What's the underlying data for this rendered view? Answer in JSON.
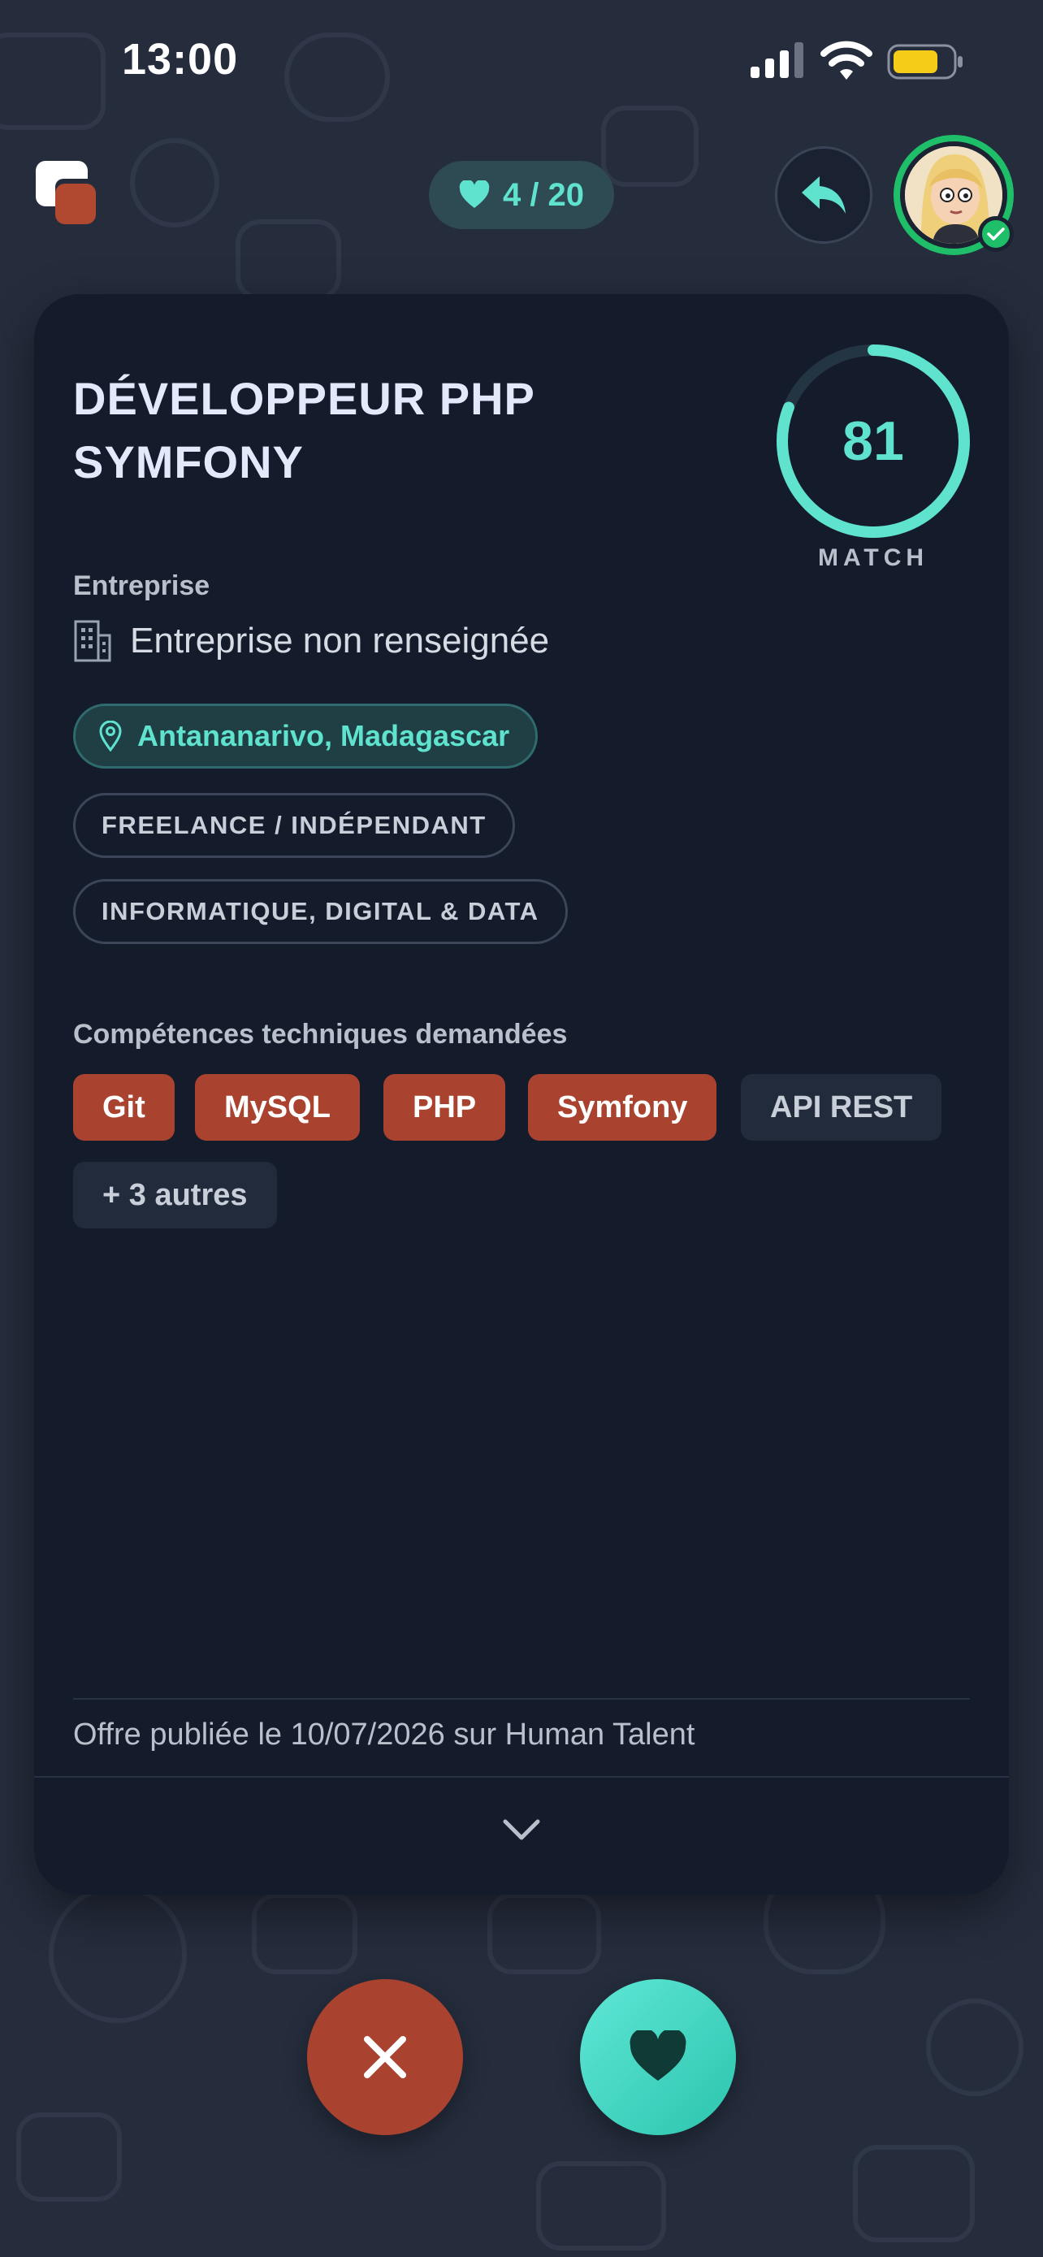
{
  "status_bar": {
    "time": "13:00",
    "icons": [
      "cellular-signal-icon",
      "wifi-icon",
      "battery-icon"
    ]
  },
  "header": {
    "logo_icon": "app-logo-icon",
    "likes_counter": "4 / 20",
    "likes_icon": "heart-icon",
    "undo_icon": "undo-arrow-icon",
    "avatar": "user-avatar",
    "avatar_status": "verified-check-icon"
  },
  "card": {
    "title": "DÉVELOPPEUR PHP SYMFONY",
    "match": {
      "score": "81",
      "label": "MATCH",
      "fraction": 0.81
    },
    "company_label": "Entreprise",
    "company_name": "Entreprise non renseignée",
    "location": "Antananarivo, Madagascar",
    "tags": [
      "FREELANCE / INDÉPENDANT",
      "INFORMATIQUE, DIGITAL & DATA"
    ],
    "skills_label": "Compétences techniques demandées",
    "skills": [
      {
        "label": "Git",
        "highlighted": true
      },
      {
        "label": "MySQL",
        "highlighted": true
      },
      {
        "label": "PHP",
        "highlighted": true
      },
      {
        "label": "Symfony",
        "highlighted": true
      },
      {
        "label": "API REST",
        "highlighted": false
      },
      {
        "label": "+ 3 autres",
        "highlighted": false
      }
    ],
    "published": "Offre publiée le 10/07/2026 sur Human Talent",
    "expand_icon": "chevron-down-icon"
  },
  "actions": {
    "reject_icon": "close-icon",
    "like_icon": "heart-icon"
  },
  "colors": {
    "background": "#252d3d",
    "card": "#141b2b",
    "accent_teal": "#5fe3cf",
    "accent_red": "#a9432f",
    "verified_green": "#1fbf6a"
  }
}
